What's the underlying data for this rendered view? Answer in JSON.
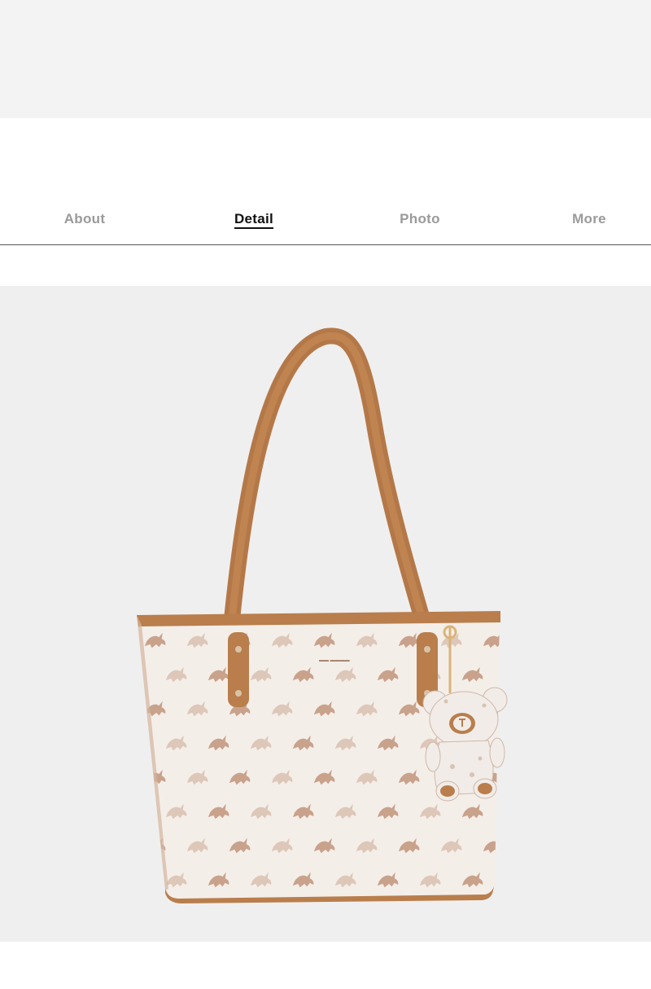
{
  "tabs": [
    {
      "label": "About",
      "active": false
    },
    {
      "label": "Detail",
      "active": true
    },
    {
      "label": "Photo",
      "active": false
    },
    {
      "label": "More",
      "active": false
    }
  ],
  "product_image": {
    "subject": "tote-bag-with-bear-charm",
    "colors": {
      "background": "#f0efef",
      "bag_body": "#f3ede8",
      "trim": "#b97e4c",
      "print": "#c9a28c",
      "print_light": "#ddc7b8"
    }
  }
}
